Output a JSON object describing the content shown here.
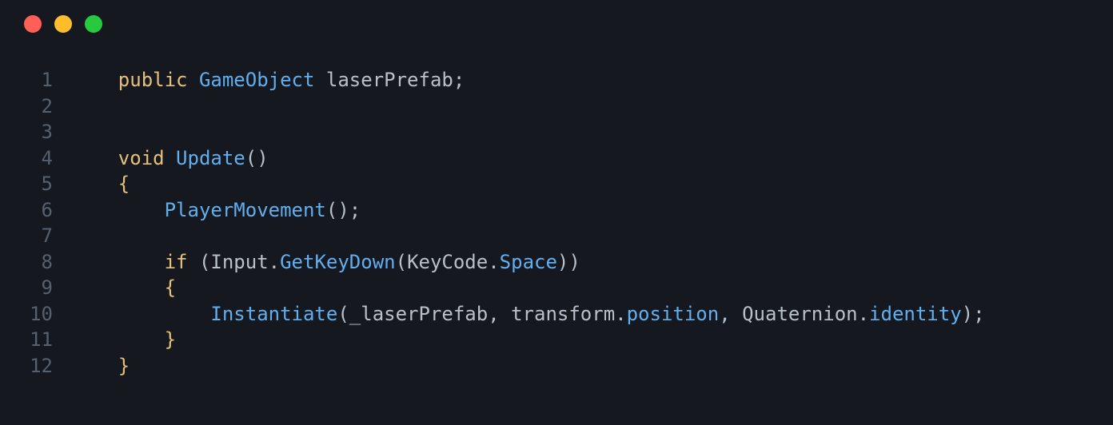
{
  "traffic_lights": [
    "red",
    "yellow",
    "green"
  ],
  "line_numbers": [
    "1",
    "2",
    "3",
    "4",
    "5",
    "6",
    "7",
    "8",
    "9",
    "10",
    "11",
    "12"
  ],
  "code": {
    "lines": [
      [
        {
          "cls": "tok-kw",
          "t": "public"
        },
        {
          "cls": "tok-punc",
          "t": " "
        },
        {
          "cls": "tok-type",
          "t": "GameObject"
        },
        {
          "cls": "tok-punc",
          "t": " "
        },
        {
          "cls": "tok-ident",
          "t": "laserPrefab"
        },
        {
          "cls": "tok-punc",
          "t": ";"
        }
      ],
      [],
      [],
      [
        {
          "cls": "tok-kw",
          "t": "void"
        },
        {
          "cls": "tok-punc",
          "t": " "
        },
        {
          "cls": "tok-type",
          "t": "Update"
        },
        {
          "cls": "tok-punc",
          "t": "()"
        }
      ],
      [
        {
          "cls": "tok-brace",
          "t": "{"
        }
      ],
      [
        {
          "cls": "tok-punc",
          "t": "    "
        },
        {
          "cls": "tok-type",
          "t": "PlayerMovement"
        },
        {
          "cls": "tok-punc",
          "t": "();"
        }
      ],
      [],
      [
        {
          "cls": "tok-punc",
          "t": "    "
        },
        {
          "cls": "tok-kw",
          "t": "if"
        },
        {
          "cls": "tok-punc",
          "t": " ("
        },
        {
          "cls": "tok-ident",
          "t": "Input"
        },
        {
          "cls": "tok-punc",
          "t": "."
        },
        {
          "cls": "tok-member",
          "t": "GetKeyDown"
        },
        {
          "cls": "tok-punc",
          "t": "("
        },
        {
          "cls": "tok-ident",
          "t": "KeyCode"
        },
        {
          "cls": "tok-punc",
          "t": "."
        },
        {
          "cls": "tok-member",
          "t": "Space"
        },
        {
          "cls": "tok-punc",
          "t": "))"
        }
      ],
      [
        {
          "cls": "tok-punc",
          "t": "    "
        },
        {
          "cls": "tok-brace",
          "t": "{"
        }
      ],
      [
        {
          "cls": "tok-punc",
          "t": "        "
        },
        {
          "cls": "tok-type",
          "t": "Instantiate"
        },
        {
          "cls": "tok-punc",
          "t": "("
        },
        {
          "cls": "tok-ident",
          "t": "_laserPrefab"
        },
        {
          "cls": "tok-punc",
          "t": ", "
        },
        {
          "cls": "tok-ident",
          "t": "transform"
        },
        {
          "cls": "tok-punc",
          "t": "."
        },
        {
          "cls": "tok-member",
          "t": "position"
        },
        {
          "cls": "tok-punc",
          "t": ", "
        },
        {
          "cls": "tok-ident",
          "t": "Quaternion"
        },
        {
          "cls": "tok-punc",
          "t": "."
        },
        {
          "cls": "tok-member",
          "t": "identity"
        },
        {
          "cls": "tok-punc",
          "t": ");"
        }
      ],
      [
        {
          "cls": "tok-punc",
          "t": "    "
        },
        {
          "cls": "tok-brace",
          "t": "}"
        }
      ],
      [
        {
          "cls": "tok-brace",
          "t": "}"
        }
      ]
    ]
  },
  "indent_prefix": "    "
}
